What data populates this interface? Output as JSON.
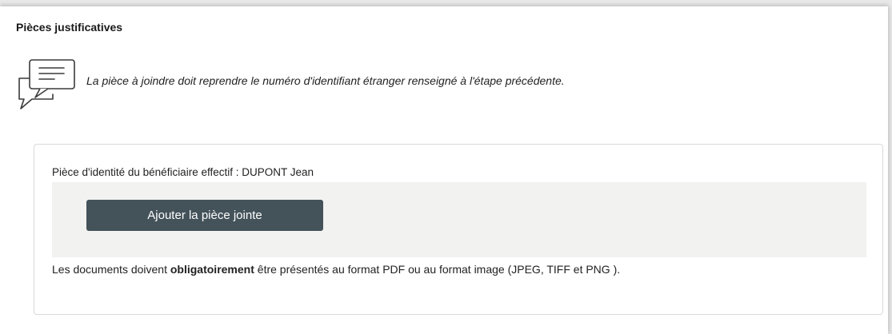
{
  "section": {
    "title": "Pièces justificatives"
  },
  "info": {
    "icon": "chat-bubbles-icon",
    "text": "La pièce à joindre doit reprendre le numéro d'identifiant étranger renseigné à l'étape précédente."
  },
  "document": {
    "label": "Pièce d'identité du bénéficiaire effectif : DUPONT Jean",
    "add_button_label": "Ajouter la pièce jointe",
    "note_before": "Les documents doivent ",
    "note_bold": "obligatoirement",
    "note_after": " être présentés au format PDF ou au format image (JPEG, TIFF et PNG )."
  },
  "colors": {
    "button_bg": "#44525a",
    "upload_area_bg": "#f2f2f0",
    "card_border": "#d9d9d9"
  }
}
